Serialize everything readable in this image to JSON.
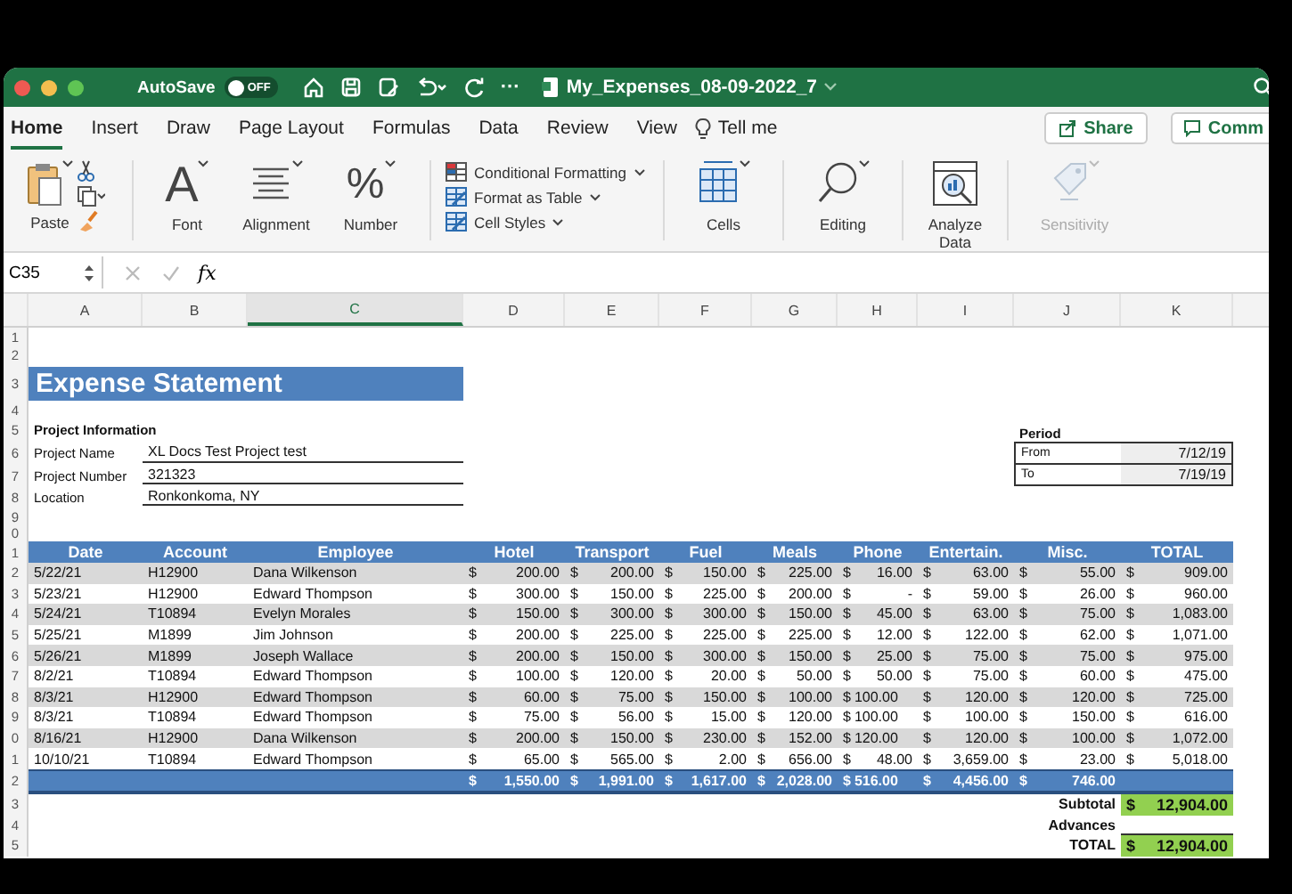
{
  "window": {
    "autosave_label": "AutoSave",
    "autosave": {
      "on": false,
      "label": "OFF"
    },
    "more": "···",
    "title": "My_Expenses_08-09-2022_7"
  },
  "tabs": [
    {
      "label": "Home",
      "selected": true
    },
    {
      "label": "Insert",
      "selected": false
    },
    {
      "label": "Draw",
      "selected": false
    },
    {
      "label": "Page Layout",
      "selected": false
    },
    {
      "label": "Formulas",
      "selected": false
    },
    {
      "label": "Data",
      "selected": false
    },
    {
      "label": "Review",
      "selected": false
    },
    {
      "label": "View",
      "selected": false
    }
  ],
  "tell_me": "Tell me",
  "buttons": [
    {
      "label": "Share"
    },
    {
      "label": "Comm"
    }
  ],
  "ribbon": [
    {
      "kind": "paste",
      "label": "Paste",
      "disabled": false
    },
    {
      "kind": "font",
      "label": "Font",
      "glyph": "A",
      "disabled": false
    },
    {
      "kind": "alignment",
      "label": "Alignment",
      "disabled": false
    },
    {
      "kind": "number",
      "label": "Number",
      "glyph": "%",
      "disabled": false
    },
    {
      "kind": "styles",
      "items": [
        "Conditional Formatting",
        "Format as Table",
        "Cell Styles"
      ],
      "disabled": false
    },
    {
      "kind": "cells",
      "label": "Cells",
      "disabled": false
    },
    {
      "kind": "editing",
      "label": "Editing",
      "disabled": false
    },
    {
      "kind": "analyze",
      "label": "Analyze Data",
      "disabled": false
    },
    {
      "kind": "sensitivity",
      "label": "Sensitivity",
      "disabled": true
    }
  ],
  "formula_bar": {
    "name_box": "C35",
    "fx": "fx"
  },
  "sheet": {
    "columns": [
      {
        "label": "A",
        "selected": false
      },
      {
        "label": "B",
        "selected": false
      },
      {
        "label": "C",
        "selected": true
      },
      {
        "label": "D",
        "selected": false
      },
      {
        "label": "E",
        "selected": false
      },
      {
        "label": "F",
        "selected": false
      },
      {
        "label": "G",
        "selected": false
      },
      {
        "label": "H",
        "selected": false
      },
      {
        "label": "I",
        "selected": false
      },
      {
        "label": "J",
        "selected": false
      },
      {
        "label": "K",
        "selected": false
      }
    ],
    "row_numbers": [
      "1",
      "2",
      "3",
      "4",
      "5",
      "6",
      "7",
      "8",
      "9",
      "0",
      "1",
      "2",
      "3",
      "4",
      "5",
      "6",
      "7",
      "8",
      "9",
      "0",
      "1",
      "2",
      "3",
      "4",
      "5"
    ],
    "title": "Expense Statement",
    "project_info": {
      "heading": "Project Information",
      "fields": [
        {
          "label": "Project Name",
          "value": "XL Docs Test Project test"
        },
        {
          "label": "Project Number",
          "value": "321323"
        },
        {
          "label": "Location",
          "value": "Ronkonkoma, NY"
        }
      ]
    },
    "period": {
      "heading": "Period",
      "rows": [
        {
          "label": "From",
          "value": "7/12/19"
        },
        {
          "label": "To",
          "value": "7/19/19"
        }
      ]
    },
    "table": {
      "columns": [
        "Date",
        "Account",
        "Employee",
        "Hotel",
        "Transport",
        "Fuel",
        "Meals",
        "Phone",
        "Entertain.",
        "Misc.",
        "TOTAL"
      ],
      "rows": [
        {
          "date": "5/22/21",
          "account": "H12900",
          "employee": "Dana Wilkenson",
          "amounts": [
            [
              "$",
              "200.00"
            ],
            [
              "$",
              "200.00"
            ],
            [
              "$",
              "150.00"
            ],
            [
              "$",
              "225.00"
            ],
            [
              "$",
              "16.00"
            ],
            [
              "$",
              "63.00"
            ],
            [
              "$",
              "55.00"
            ],
            [
              "$",
              "909.00"
            ]
          ]
        },
        {
          "date": "5/23/21",
          "account": "H12900",
          "employee": "Edward Thompson",
          "amounts": [
            [
              "$",
              "300.00"
            ],
            [
              "$",
              "150.00"
            ],
            [
              "$",
              "225.00"
            ],
            [
              "$",
              "200.00"
            ],
            [
              "$",
              "-"
            ],
            [
              "$",
              "59.00"
            ],
            [
              "$",
              "26.00"
            ],
            [
              "$",
              "960.00"
            ]
          ]
        },
        {
          "date": "5/24/21",
          "account": "T10894",
          "employee": "Evelyn Morales",
          "amounts": [
            [
              "$",
              "150.00"
            ],
            [
              "$",
              "300.00"
            ],
            [
              "$",
              "300.00"
            ],
            [
              "$",
              "150.00"
            ],
            [
              "$",
              "45.00"
            ],
            [
              "$",
              "63.00"
            ],
            [
              "$",
              "75.00"
            ],
            [
              "$",
              "1,083.00"
            ]
          ]
        },
        {
          "date": "5/25/21",
          "account": "M1899",
          "employee": "Jim Johnson",
          "amounts": [
            [
              "$",
              "200.00"
            ],
            [
              "$",
              "225.00"
            ],
            [
              "$",
              "225.00"
            ],
            [
              "$",
              "225.00"
            ],
            [
              "$",
              "12.00"
            ],
            [
              "$",
              "122.00"
            ],
            [
              "$",
              "62.00"
            ],
            [
              "$",
              "1,071.00"
            ]
          ]
        },
        {
          "date": "5/26/21",
          "account": "M1899",
          "employee": "Joseph Wallace",
          "amounts": [
            [
              "$",
              "200.00"
            ],
            [
              "$",
              "150.00"
            ],
            [
              "$",
              "300.00"
            ],
            [
              "$",
              "150.00"
            ],
            [
              "$",
              "25.00"
            ],
            [
              "$",
              "75.00"
            ],
            [
              "$",
              "75.00"
            ],
            [
              "$",
              "975.00"
            ]
          ]
        },
        {
          "date": "8/2/21",
          "account": "T10894",
          "employee": "Edward Thompson",
          "amounts": [
            [
              "$",
              "100.00"
            ],
            [
              "$",
              "120.00"
            ],
            [
              "$",
              "20.00"
            ],
            [
              "$",
              "50.00"
            ],
            [
              "$",
              "50.00"
            ],
            [
              "$",
              "75.00"
            ],
            [
              "$",
              "60.00"
            ],
            [
              "$",
              "475.00"
            ]
          ]
        },
        {
          "date": "8/3/21",
          "account": "H12900",
          "employee": "Edward Thompson",
          "amounts": [
            [
              "$",
              "60.00"
            ],
            [
              "$",
              "75.00"
            ],
            [
              "$",
              "150.00"
            ],
            [
              "$",
              "100.00"
            ],
            [
              "$",
              "100.00"
            ],
            [
              "$",
              "120.00"
            ],
            [
              "$",
              "120.00"
            ],
            [
              "$",
              "725.00"
            ]
          ]
        },
        {
          "date": "8/3/21",
          "account": "T10894",
          "employee": "Edward Thompson",
          "amounts": [
            [
              "$",
              "75.00"
            ],
            [
              "$",
              "56.00"
            ],
            [
              "$",
              "15.00"
            ],
            [
              "$",
              "120.00"
            ],
            [
              "$",
              "100.00"
            ],
            [
              "$",
              "100.00"
            ],
            [
              "$",
              "150.00"
            ],
            [
              "$",
              "616.00"
            ]
          ]
        },
        {
          "date": "8/16/21",
          "account": "H12900",
          "employee": "Dana Wilkenson",
          "amounts": [
            [
              "$",
              "200.00"
            ],
            [
              "$",
              "150.00"
            ],
            [
              "$",
              "230.00"
            ],
            [
              "$",
              "152.00"
            ],
            [
              "$",
              "120.00"
            ],
            [
              "$",
              "120.00"
            ],
            [
              "$",
              "100.00"
            ],
            [
              "$",
              "1,072.00"
            ]
          ]
        },
        {
          "date": "10/10/21",
          "account": "T10894",
          "employee": "Edward Thompson",
          "amounts": [
            [
              "$",
              "65.00"
            ],
            [
              "$",
              "565.00"
            ],
            [
              "$",
              "2.00"
            ],
            [
              "$",
              "656.00"
            ],
            [
              "$",
              "48.00"
            ],
            [
              "$",
              "3,659.00"
            ],
            [
              "$",
              "23.00"
            ],
            [
              "$",
              "5,018.00"
            ]
          ]
        }
      ],
      "totals": [
        [
          "$",
          "1,550.00"
        ],
        [
          "$",
          "1,991.00"
        ],
        [
          "$",
          "1,617.00"
        ],
        [
          "$",
          "2,028.00"
        ],
        [
          "$",
          "516.00"
        ],
        [
          "$",
          "4,456.00"
        ],
        [
          "$",
          "746.00"
        ]
      ],
      "summary": [
        {
          "label": "Subtotal",
          "value": [
            "$",
            "12,904.00"
          ]
        },
        {
          "label": "Advances"
        },
        {
          "label": "TOTAL",
          "value": [
            "$",
            "12,904.00"
          ]
        }
      ]
    }
  }
}
